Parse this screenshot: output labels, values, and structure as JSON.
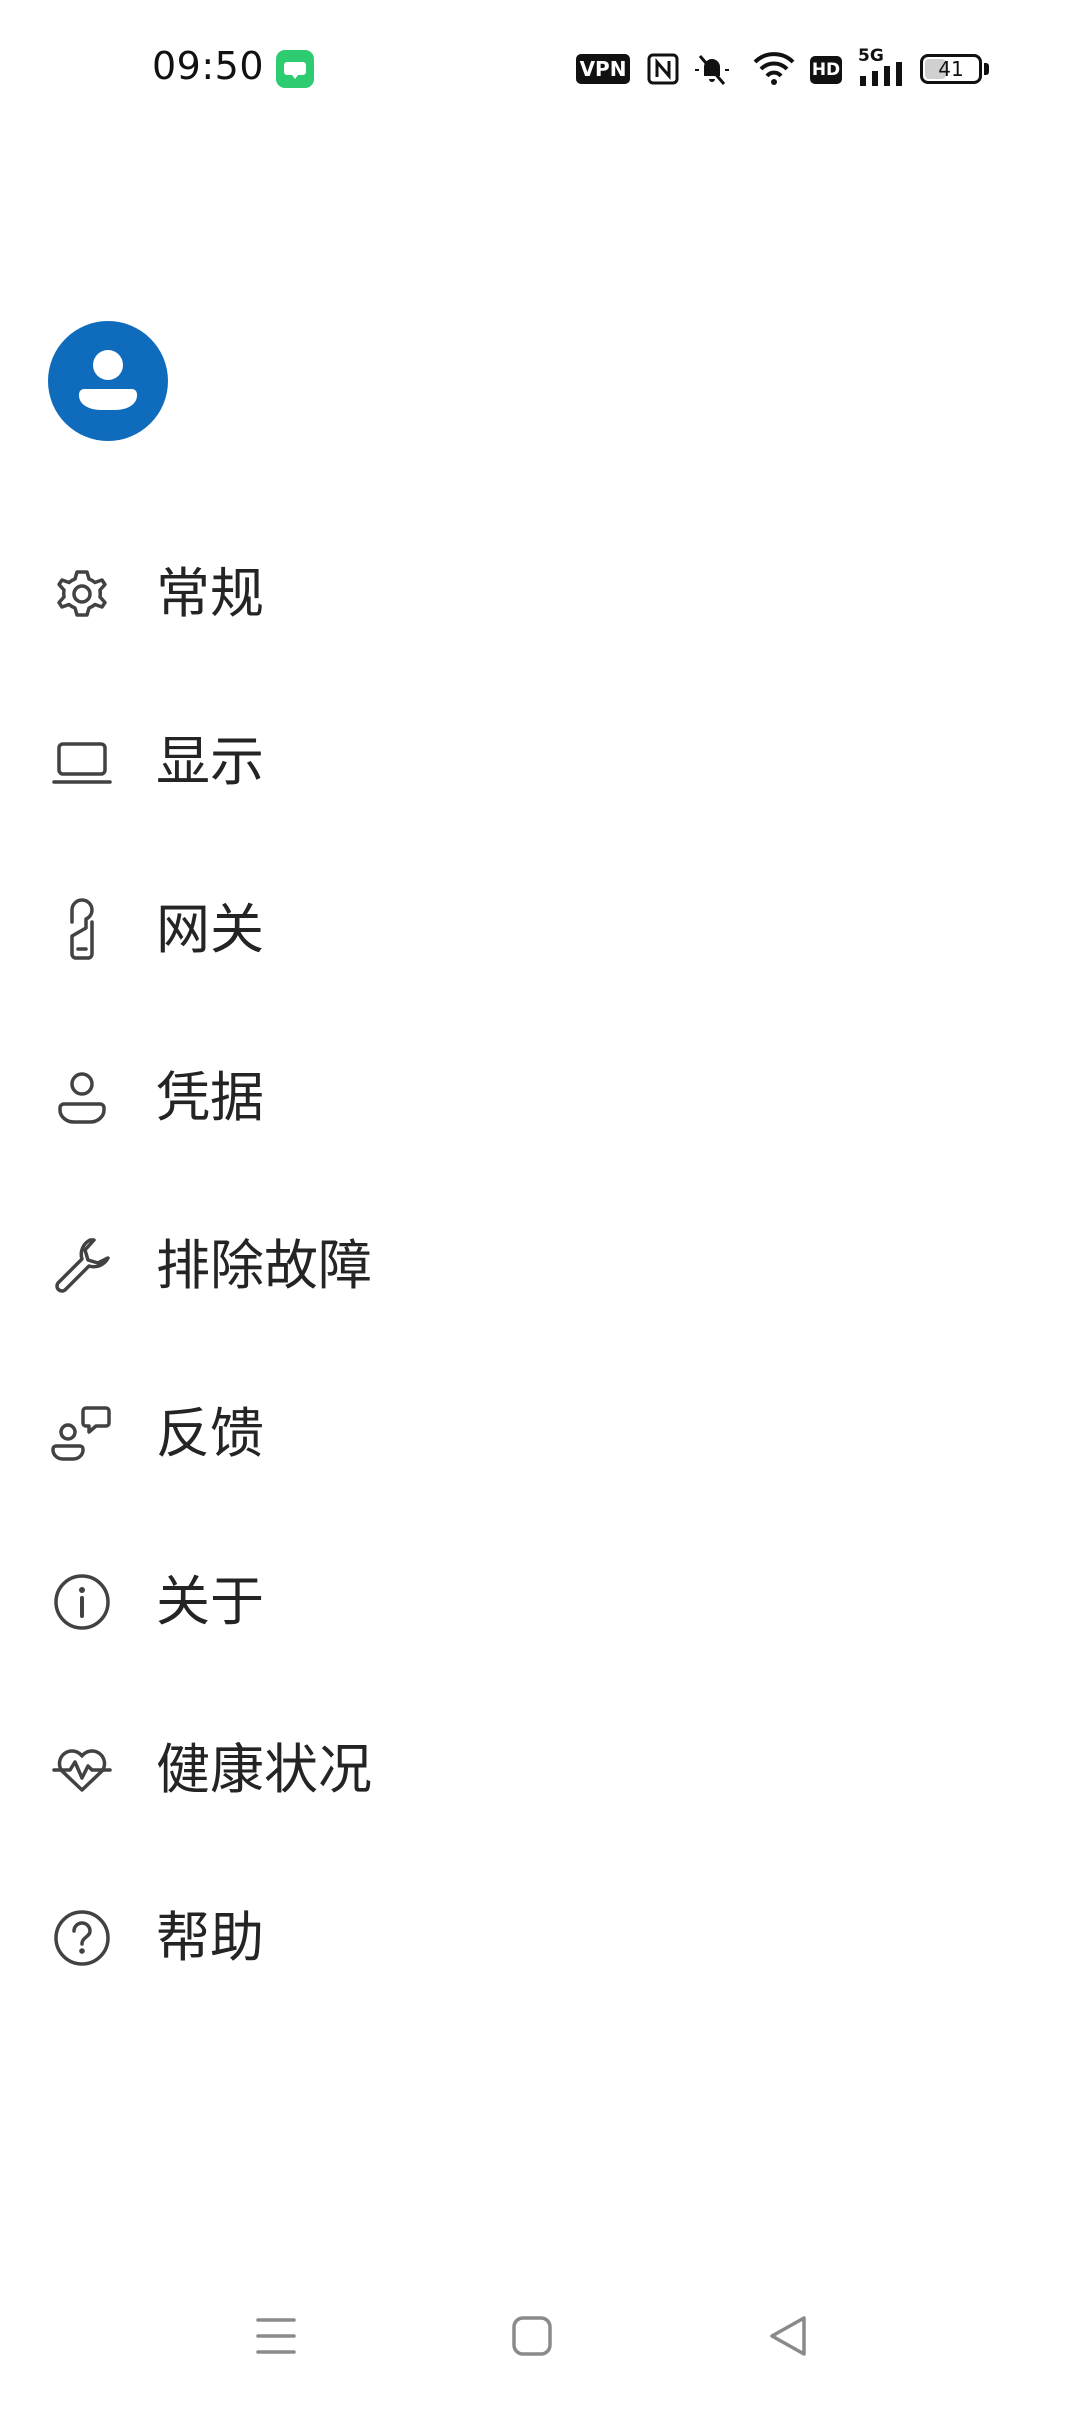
{
  "status_bar": {
    "time": "09:50",
    "vpn": "VPN",
    "hd": "HD",
    "network": "5G",
    "battery": "41",
    "battery_level": 0.41
  },
  "menu": {
    "items": [
      {
        "label": "常规",
        "icon": "gear-icon"
      },
      {
        "label": "显示",
        "icon": "laptop-icon"
      },
      {
        "label": "网关",
        "icon": "door-hanger-icon"
      },
      {
        "label": "凭据",
        "icon": "person-icon"
      },
      {
        "label": "排除故障",
        "icon": "wrench-icon"
      },
      {
        "label": "反馈",
        "icon": "person-feedback-icon"
      },
      {
        "label": "关于",
        "icon": "info-icon"
      },
      {
        "label": "健康状况",
        "icon": "heart-pulse-icon"
      },
      {
        "label": "帮助",
        "icon": "question-circle-icon"
      }
    ]
  },
  "colors": {
    "accent": "#0f6cbd",
    "text": "#242424",
    "icon": "#424242"
  }
}
